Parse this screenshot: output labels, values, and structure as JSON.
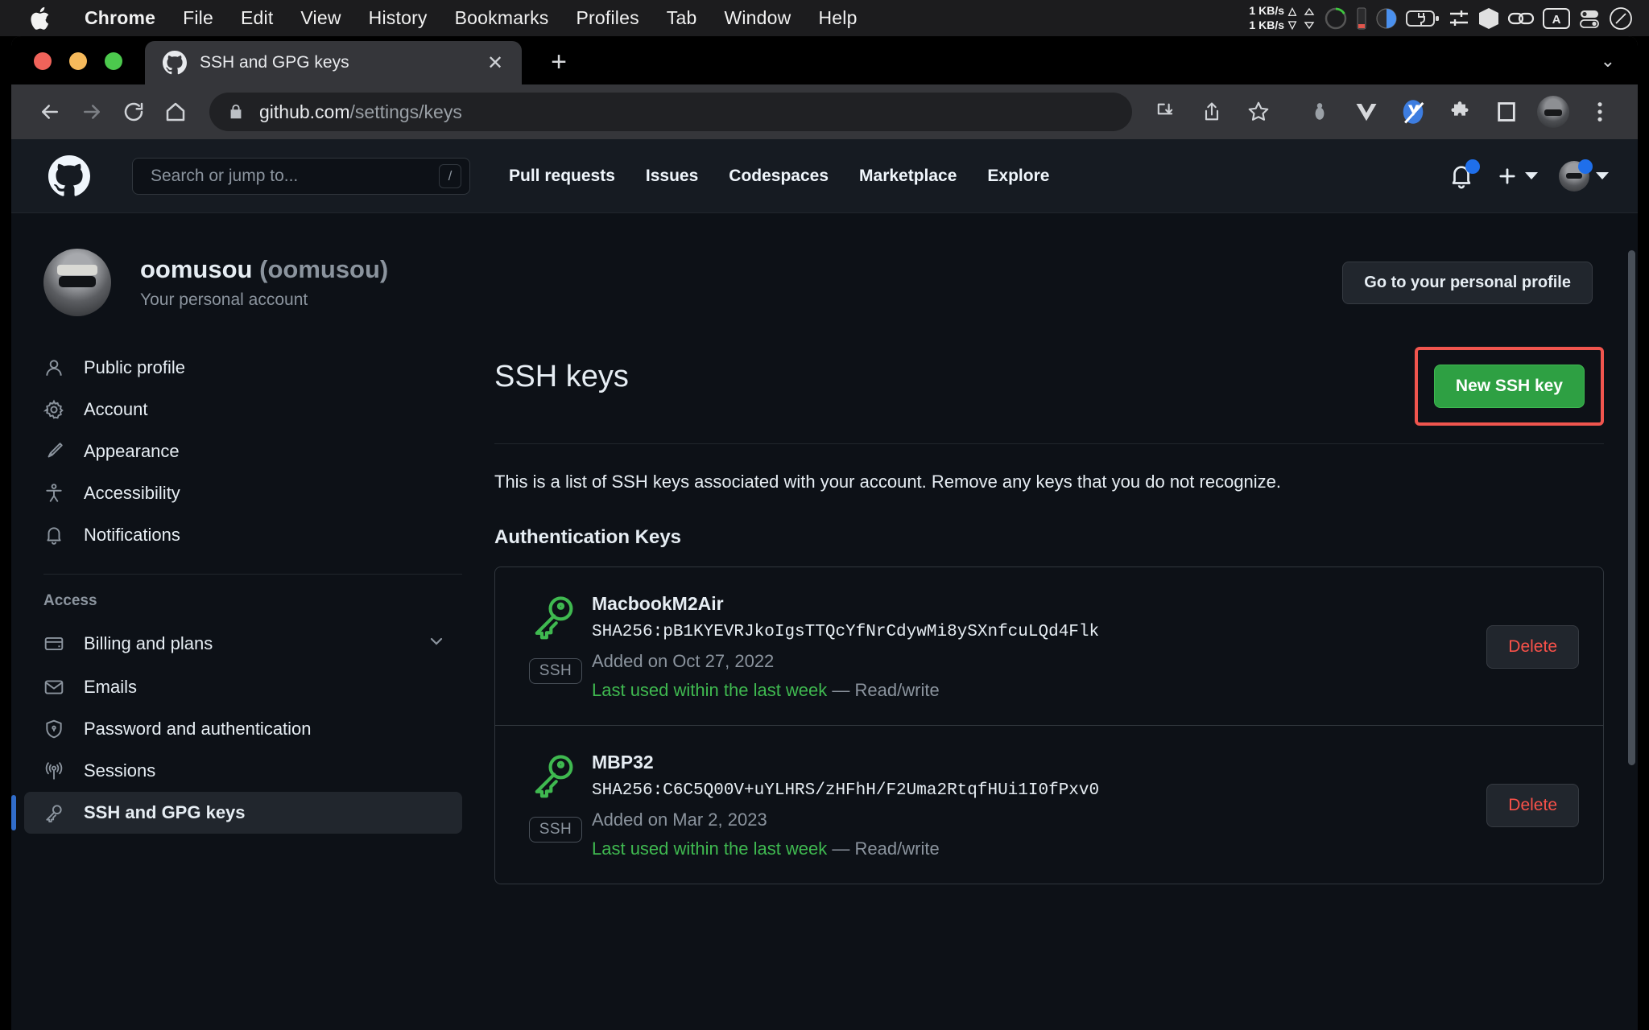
{
  "macbar": {
    "apple_icon": "apple-logo",
    "menus": [
      "Chrome",
      "File",
      "Edit",
      "View",
      "History",
      "Bookmarks",
      "Profiles",
      "Tab",
      "Window",
      "Help"
    ],
    "active_menu": "Chrome",
    "network": {
      "up": "1 KB/s",
      "down": "1 KB/s",
      "up_arrow": "△",
      "down_arrow": "▽"
    },
    "status_icons": [
      "updown-arrows-icon",
      "cpu-gauge-icon",
      "memory-bar-icon",
      "disk-pie-icon",
      "battery-charging-icon",
      "sliders-icon",
      "cube-icon",
      "link-icon",
      "input-source-a-icon",
      "control-center-icon",
      "siri-icon"
    ]
  },
  "chrome": {
    "traffic_lights": [
      "close",
      "minimize",
      "zoom"
    ],
    "tab": {
      "title": "SSH and GPG keys",
      "favicon": "github-icon",
      "close_label": "✕"
    },
    "new_tab_label": "+",
    "tab_list_label": "⌄",
    "nav": {
      "back_icon": "back-arrow-icon",
      "forward_icon": "forward-arrow-icon",
      "reload_icon": "reload-icon",
      "home_icon": "home-icon"
    },
    "address": {
      "lock_icon": "lock-icon",
      "host": "github.com",
      "path": "/settings/keys",
      "full": "github.com/settings/keys"
    },
    "toolbar_icons": [
      "install-app-icon",
      "share-icon",
      "bookmark-star-icon",
      "bug-extension-icon",
      "vue-devtools-icon",
      "vimium-icon",
      "puzzle-extensions-icon",
      "side-panel-icon"
    ],
    "profile_icon": "chrome-profile-avatar",
    "menu_icon": "three-dot-menu-icon"
  },
  "github": {
    "header": {
      "logo": "github-mark-icon",
      "search": {
        "placeholder": "Search or jump to...",
        "shortcut": "/"
      },
      "nav": [
        "Pull requests",
        "Issues",
        "Codespaces",
        "Marketplace",
        "Explore"
      ],
      "notifications_icon": "bell-icon",
      "create_new_icon": "plus-icon",
      "avatar": "user-avatar"
    },
    "profile": {
      "username": "oomusou",
      "handle": "(oomusou)",
      "subtitle": "Your personal account",
      "goto_button": "Go to your personal profile"
    },
    "sidebar": {
      "items": [
        {
          "label": "Public profile",
          "icon": "person-icon",
          "active": false
        },
        {
          "label": "Account",
          "icon": "gear-icon",
          "active": false
        },
        {
          "label": "Appearance",
          "icon": "paintbrush-icon",
          "active": false
        },
        {
          "label": "Accessibility",
          "icon": "accessibility-icon",
          "active": false
        },
        {
          "label": "Notifications",
          "icon": "bell-icon",
          "active": false
        }
      ],
      "section_label": "Access",
      "access_items": [
        {
          "label": "Billing and plans",
          "icon": "credit-card-icon",
          "active": false,
          "chevron": true
        },
        {
          "label": "Emails",
          "icon": "mail-icon",
          "active": false,
          "chevron": false
        },
        {
          "label": "Password and authentication",
          "icon": "shield-lock-icon",
          "active": false,
          "chevron": false
        },
        {
          "label": "Sessions",
          "icon": "broadcast-icon",
          "active": false,
          "chevron": false
        },
        {
          "label": "SSH and GPG keys",
          "icon": "key-icon",
          "active": true,
          "chevron": false
        }
      ]
    },
    "main": {
      "title": "SSH keys",
      "new_key_button": "New SSH key",
      "new_key_highlight_color": "#f0554e",
      "new_key_button_color": "#2ea043",
      "description": "This is a list of SSH keys associated with your account. Remove any keys that you do not recognize.",
      "section_title": "Authentication Keys",
      "delete_label": "Delete",
      "keys": [
        {
          "name": "MacbookM2Air",
          "fingerprint": "SHA256:pB1KYEVRJkoIgsTTQcYfNrCdywMi8ySXnfcuLQd4Flk",
          "added": "Added on Oct 27, 2022",
          "last_used": "Last used within the last week",
          "permission": "— Read/write",
          "badge": "SSH",
          "key_icon": "key-icon"
        },
        {
          "name": "MBP32",
          "fingerprint": "SHA256:C6C5Q00V+uYLHRS/zHFhH/F2Uma2RtqfHUi1I0fPxv0",
          "added": "Added on Mar 2, 2023",
          "last_used": "Last used within the last week",
          "permission": "— Read/write",
          "badge": "SSH",
          "key_icon": "key-icon"
        }
      ]
    }
  }
}
